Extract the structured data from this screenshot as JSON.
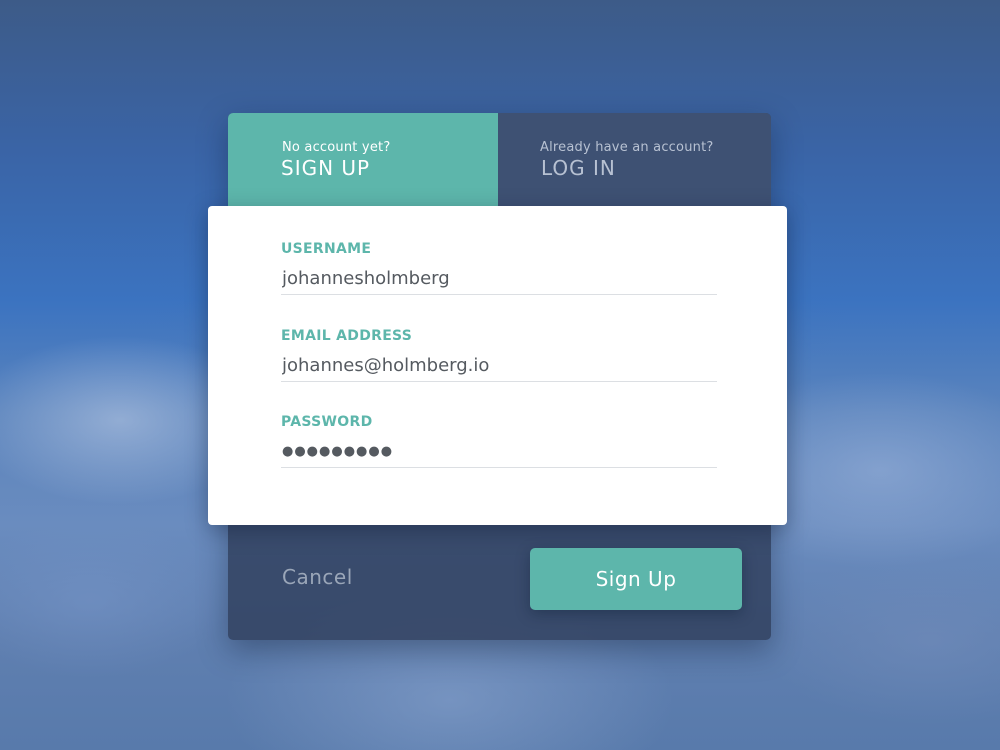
{
  "tabs": {
    "signup": {
      "hint": "No account yet?",
      "title": "SIGN UP"
    },
    "login": {
      "hint": "Already have an account?",
      "title": "LOG IN"
    }
  },
  "form": {
    "username": {
      "label": "USERNAME",
      "value": "johannesholmberg"
    },
    "email": {
      "label": "EMAIL ADDRESS",
      "value": "johannes@holmberg.io"
    },
    "password": {
      "label": "PASSWORD",
      "value": "●●●●●●●●●"
    }
  },
  "actions": {
    "cancel_label": "Cancel",
    "submit_label": "Sign Up"
  },
  "colors": {
    "accent": "#5db6ab",
    "inactive_tab": "#3e5173",
    "panel": "#ffffff"
  }
}
